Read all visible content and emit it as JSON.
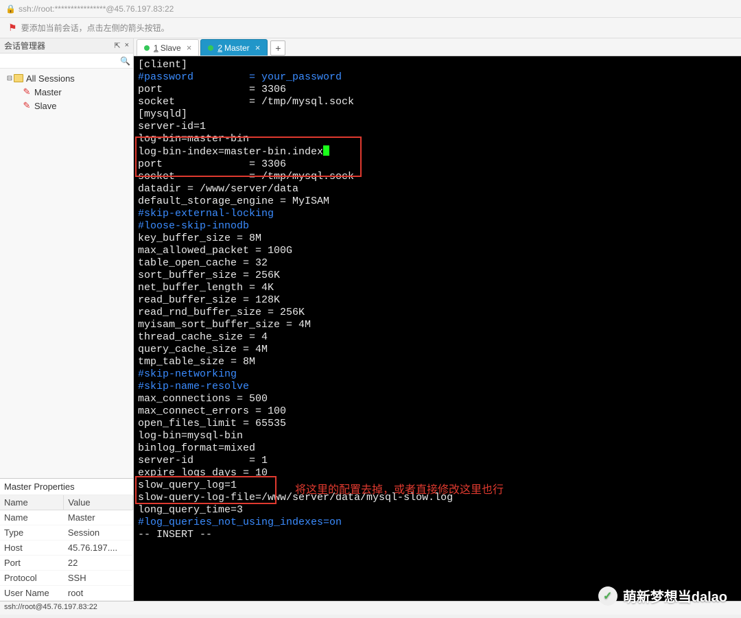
{
  "topbar": {
    "address": "ssh://root:****************@45.76.197.83:22"
  },
  "infobar": {
    "text": "要添加当前会话，点击左侧的箭头按钮。"
  },
  "sidebar": {
    "panel_title": "会话管理器",
    "pin_glyph": "⇱",
    "close_glyph": "×",
    "search_glyph": "🔍",
    "tree": {
      "root": "All Sessions",
      "expand_glyph": "⊟",
      "items": [
        "Master",
        "Slave"
      ]
    }
  },
  "tabs": {
    "list": [
      {
        "num": "1",
        "label": "Slave",
        "active": false
      },
      {
        "num": "2",
        "label": "Master",
        "active": true
      }
    ],
    "add_glyph": "+",
    "close_glyph": "×"
  },
  "terminal": {
    "lines": [
      {
        "cls": "t-white",
        "text": "[client]"
      },
      {
        "cls": "t-blue",
        "text": "#password         = your_password"
      },
      {
        "cls": "t-white",
        "text": "port              = 3306"
      },
      {
        "cls": "t-white",
        "text": "socket            = /tmp/mysql.sock"
      },
      {
        "cls": "t-white",
        "text": ""
      },
      {
        "cls": "t-white",
        "text": "[mysqld]"
      },
      {
        "cls": "t-white",
        "text": "server-id=1"
      },
      {
        "cls": "t-white",
        "text": "log-bin=master-bin"
      },
      {
        "cls": "t-white",
        "text": "log-bin-index=master-bin.index",
        "cursor": true
      },
      {
        "cls": "t-white",
        "text": "port              = 3306"
      },
      {
        "cls": "t-white",
        "text": "socket            = /tmp/mysql.sock"
      },
      {
        "cls": "t-white",
        "text": "datadir = /www/server/data"
      },
      {
        "cls": "t-white",
        "text": "default_storage_engine = MyISAM"
      },
      {
        "cls": "t-blue",
        "text": "#skip-external-locking"
      },
      {
        "cls": "t-blue",
        "text": "#loose-skip-innodb"
      },
      {
        "cls": "t-white",
        "text": "key_buffer_size = 8M"
      },
      {
        "cls": "t-white",
        "text": "max_allowed_packet = 100G"
      },
      {
        "cls": "t-white",
        "text": "table_open_cache = 32"
      },
      {
        "cls": "t-white",
        "text": "sort_buffer_size = 256K"
      },
      {
        "cls": "t-white",
        "text": "net_buffer_length = 4K"
      },
      {
        "cls": "t-white",
        "text": "read_buffer_size = 128K"
      },
      {
        "cls": "t-white",
        "text": "read_rnd_buffer_size = 256K"
      },
      {
        "cls": "t-white",
        "text": "myisam_sort_buffer_size = 4M"
      },
      {
        "cls": "t-white",
        "text": "thread_cache_size = 4"
      },
      {
        "cls": "t-white",
        "text": "query_cache_size = 4M"
      },
      {
        "cls": "t-white",
        "text": "tmp_table_size = 8M"
      },
      {
        "cls": "t-white",
        "text": ""
      },
      {
        "cls": "t-blue",
        "text": "#skip-networking"
      },
      {
        "cls": "t-blue",
        "text": "#skip-name-resolve"
      },
      {
        "cls": "t-white",
        "text": "max_connections = 500"
      },
      {
        "cls": "t-white",
        "text": "max_connect_errors = 100"
      },
      {
        "cls": "t-white",
        "text": "open_files_limit = 65535"
      },
      {
        "cls": "t-white",
        "text": ""
      },
      {
        "cls": "t-white",
        "text": "log-bin=mysql-bin"
      },
      {
        "cls": "t-white",
        "text": "binlog_format=mixed"
      },
      {
        "cls": "t-white",
        "text": "server-id         = 1"
      },
      {
        "cls": "t-white",
        "text": "expire_logs_days = 10"
      },
      {
        "cls": "t-white",
        "text": "slow_query_log=1"
      },
      {
        "cls": "t-white",
        "text": "slow-query-log-file=/www/server/data/mysql-slow.log"
      },
      {
        "cls": "t-white",
        "text": "long_query_time=3"
      },
      {
        "cls": "t-blue",
        "text": "#log_queries_not_using_indexes=on"
      },
      {
        "cls": "t-white",
        "text": "-- INSERT --"
      }
    ],
    "annotation": "将这里的配置去掉，或者直接修改这里也行"
  },
  "props": {
    "title": "Master Properties",
    "col_name": "Name",
    "col_value": "Value",
    "rows": [
      {
        "k": "Name",
        "v": "Master"
      },
      {
        "k": "Type",
        "v": "Session"
      },
      {
        "k": "Host",
        "v": "45.76.197...."
      },
      {
        "k": "Port",
        "v": "22"
      },
      {
        "k": "Protocol",
        "v": "SSH"
      },
      {
        "k": "User Name",
        "v": "root"
      }
    ]
  },
  "statusbar": {
    "text": "ssh://root@45.76.197.83:22"
  },
  "watermark": {
    "text": "萌新梦想当dalao",
    "icon": "✓"
  }
}
